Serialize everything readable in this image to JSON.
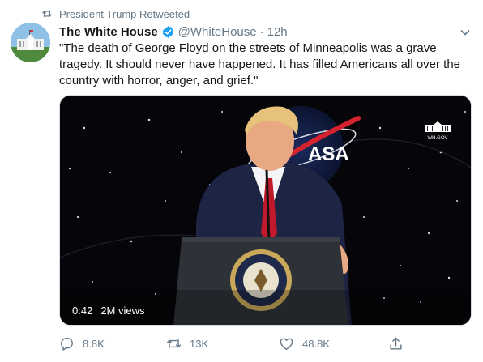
{
  "retweet_banner": {
    "icon": "retweet-icon",
    "text": "President Trump Retweeted"
  },
  "author": {
    "name": "The White House",
    "handle": "@WhiteHouse",
    "separator": "·",
    "time": "12h",
    "verified": true
  },
  "tweet_text": "\"The death of George Floyd on the streets of Minneapolis was a grave tragedy. It should never have happened. It has filled Americans all over the country with horror, anger, and grief.\"",
  "media": {
    "duration": "0:42",
    "views": "2M views",
    "watermark": "WH.GOV",
    "backdrop_logo_text": "ASA"
  },
  "actions": {
    "reply_count": "8.8K",
    "retweet_count": "13K",
    "like_count": "48.8K"
  },
  "colors": {
    "secondary_text": "#657786",
    "verified_blue": "#1da1f2",
    "video_bg": "#06060a"
  }
}
